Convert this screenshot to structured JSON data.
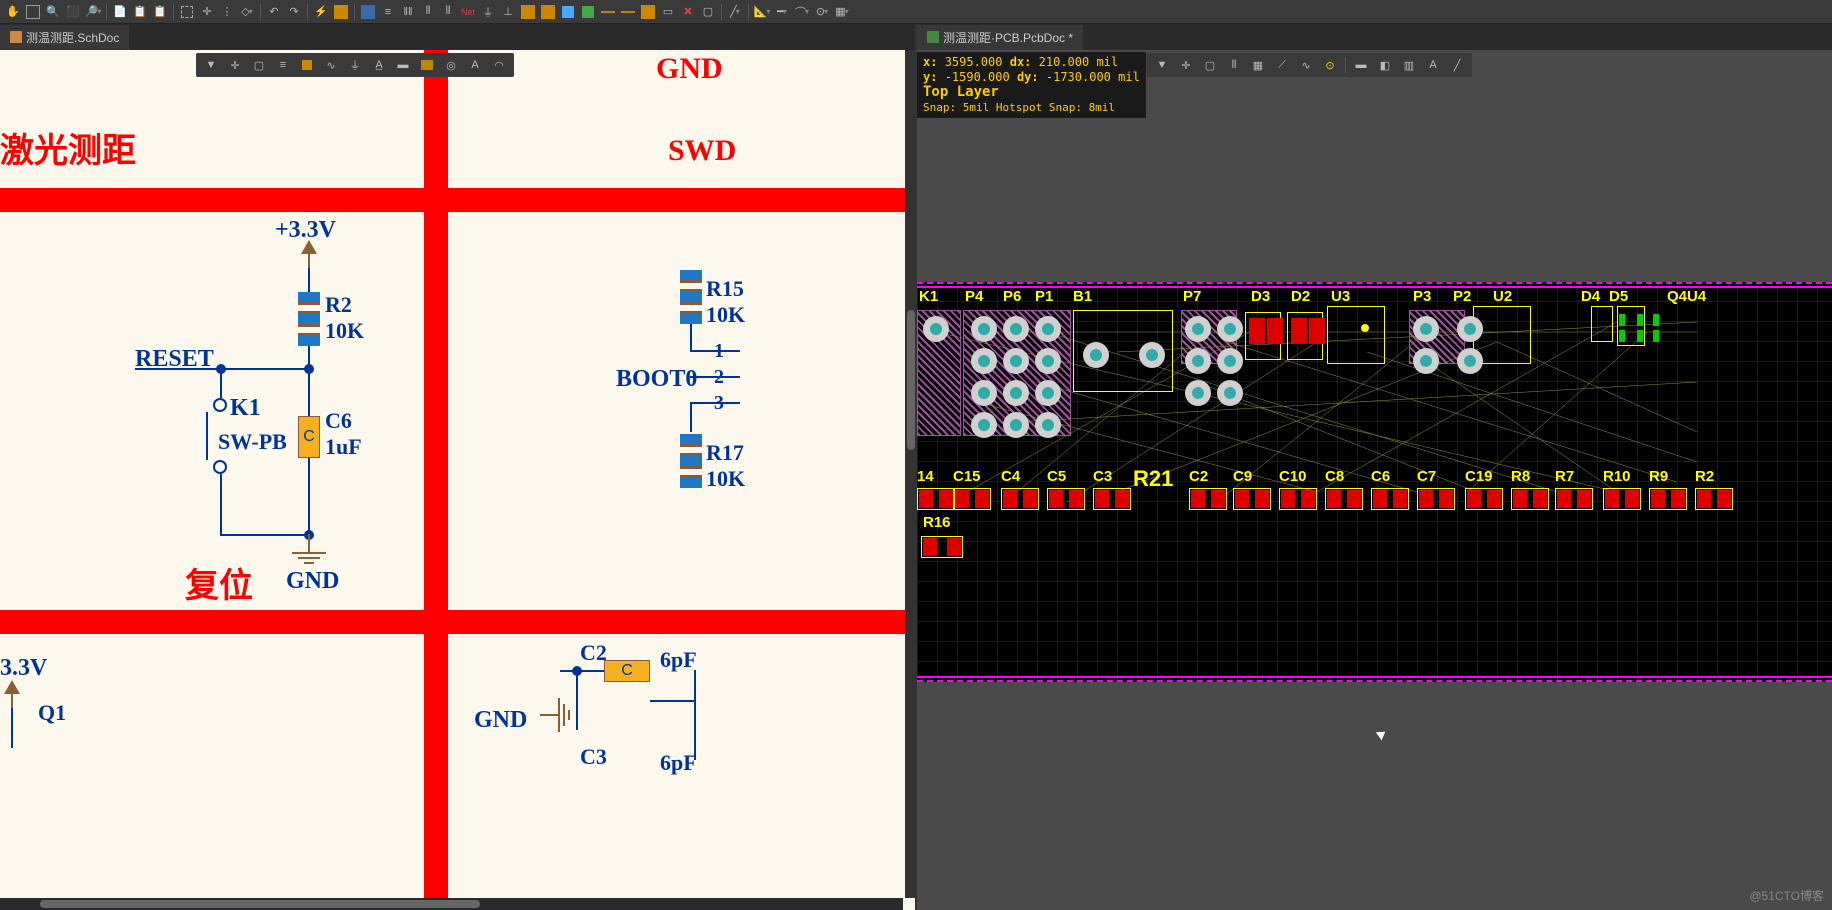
{
  "tabs": {
    "left": "测温测距.SchDoc",
    "right": "测温测距·PCB.PcbDoc *"
  },
  "schematic": {
    "title_laser": "激光测距",
    "title_reset": "复位",
    "title_swd": "SWD",
    "volt_33v": "+3.3V",
    "volt_33v_b": "3.3V",
    "net_reset": "RESET",
    "net_boot0": "BOOT0",
    "net_gnd_top": "GND",
    "net_gnd_main": "GND",
    "net_gnd_b": "GND",
    "r2_ref": "R2",
    "r2_val": "10K",
    "r15_ref": "R15",
    "r15_val": "10K",
    "r17_ref": "R17",
    "r17_val": "10K",
    "c6_ref": "C6",
    "c6_val": "1uF",
    "c2_ref": "C2",
    "c2_val": "6pF",
    "c3_ref": "C3",
    "c3_val": "6pF",
    "k1_ref": "K1",
    "sw_type": "SW-PB",
    "q1_ref": "Q1",
    "pin_1": "1",
    "pin_2": "2",
    "pin_3": "3"
  },
  "pcb": {
    "info_x_label": "x:",
    "info_x": "3595.000",
    "info_dx_label": "dx:",
    "info_dx": "210.000",
    "info_unit": "mil",
    "info_y_label": "y:",
    "info_y": "-1590.000",
    "info_dy_label": "dy:",
    "info_dy": "-1730.000",
    "layer": "Top Layer",
    "snap": "Snap: 5mil Hotspot Snap: 8mil",
    "refs_top": [
      "K1",
      "P4",
      "P6",
      "P1",
      "B1",
      "P7",
      "D3",
      "D2",
      "U3",
      "P3",
      "P2",
      "U2",
      "D4",
      "D5",
      "U4",
      "Q4"
    ],
    "r21": "R21",
    "refs_bot": [
      "14",
      "C15",
      "C4",
      "C5",
      "C3",
      "C2",
      "C9",
      "C10",
      "C8",
      "C6",
      "C7",
      "C19",
      "R8",
      "R7",
      "R10",
      "R9",
      "R2"
    ],
    "r16": "R16"
  },
  "watermark": "@51CTO博客"
}
